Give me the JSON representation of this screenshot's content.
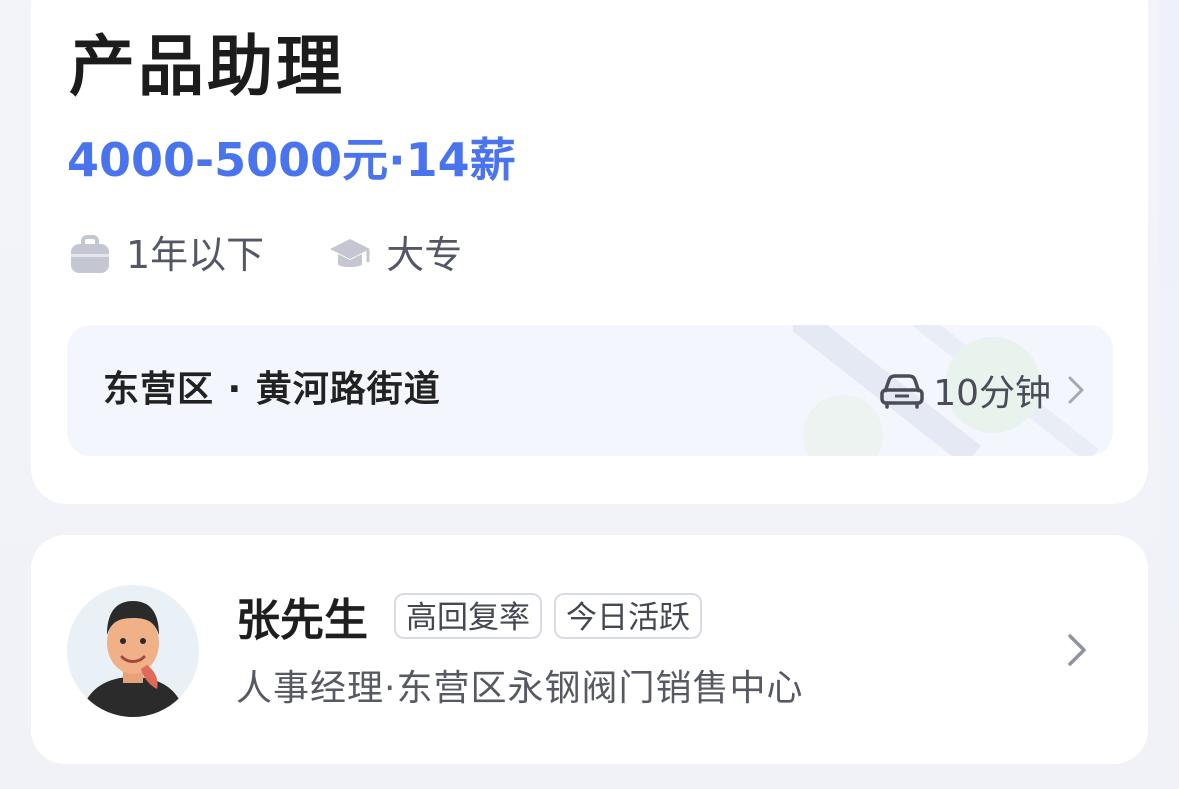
{
  "job": {
    "title": "产品助理",
    "salary": "4000-5000元·14薪",
    "tags": [
      {
        "icon": "briefcase-icon",
        "label": "1年以下"
      },
      {
        "icon": "graduation-cap-icon",
        "label": "大专"
      }
    ],
    "location": {
      "address": "东营区 · 黄河路街道",
      "commute_icon": "car-icon",
      "commute_time": "10分钟"
    }
  },
  "recruiter": {
    "name": "张先生",
    "badges": [
      "高回复率",
      "今日活跃"
    ],
    "subtitle": "人事经理·东营区永钢阀门销售中心"
  },
  "colors": {
    "accent": "#4a74ee",
    "background": "#f2f4fa",
    "card": "#ffffff"
  }
}
